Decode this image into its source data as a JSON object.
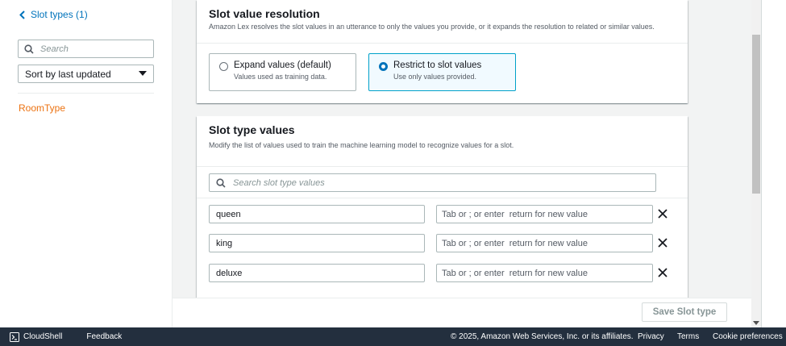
{
  "sidebar": {
    "back_link": "Slot types (1)",
    "search_placeholder": "Search",
    "sort_label": "Sort by last updated",
    "items": [
      {
        "label": "RoomType"
      }
    ]
  },
  "resolution_panel": {
    "title": "Slot value resolution",
    "description": "Amazon Lex resolves the slot values in an utterance to only the values you provide, or it expands the resolution to related or similar values.",
    "options": [
      {
        "label": "Expand values (default)",
        "sublabel": "Values used as training data.",
        "selected": false
      },
      {
        "label": "Restrict to slot values",
        "sublabel": "Use only values provided.",
        "selected": true
      }
    ]
  },
  "values_panel": {
    "title": "Slot type values",
    "description": "Modify the list of values used to train the machine learning model to recognize values for a slot.",
    "search_placeholder": "Search slot type values",
    "synonym_placeholder": "Tab or ; or enter  return for new value",
    "values": [
      {
        "value": "queen"
      },
      {
        "value": "king"
      },
      {
        "value": "deluxe"
      }
    ]
  },
  "actions": {
    "save_label": "Save Slot type"
  },
  "footer": {
    "cloudshell": "CloudShell",
    "feedback": "Feedback",
    "copyright": "© 2025, Amazon Web Services, Inc. or its affiliates.",
    "privacy": "Privacy",
    "terms": "Terms",
    "cookie": "Cookie preferences"
  },
  "colors": {
    "link_blue": "#0073bb",
    "accent_orange": "#ec7211",
    "selected_border": "#00a1c9",
    "footer_bg": "#232f3e"
  }
}
